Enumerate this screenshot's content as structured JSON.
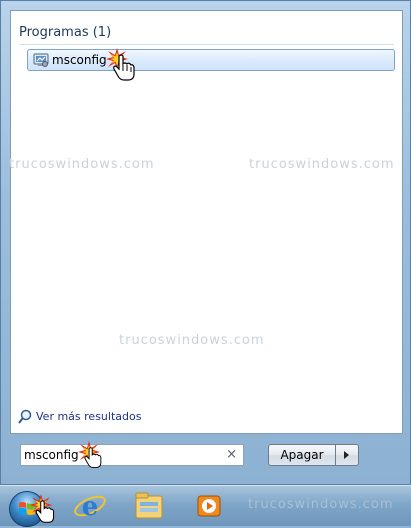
{
  "start_menu": {
    "section_title": "Programas (1)",
    "results": [
      {
        "label": "msconfig"
      }
    ],
    "more_results_label": "Ver más resultados",
    "search": {
      "value": "msconfig",
      "clear_symbol": "×"
    },
    "shutdown": {
      "label": "Apagar"
    }
  },
  "watermark": "trucoswindows.com",
  "taskbar": {
    "items": [
      {
        "icon": "start-orb-icon"
      },
      {
        "icon": "internet-explorer-icon"
      },
      {
        "icon": "windows-explorer-icon"
      },
      {
        "icon": "media-player-icon"
      }
    ]
  },
  "colors": {
    "selection_border": "#7da2ce",
    "link_text": "#1e3287",
    "section_title": "#1e395b"
  }
}
